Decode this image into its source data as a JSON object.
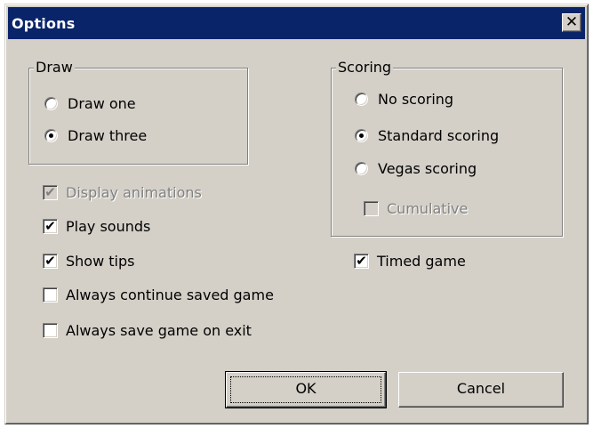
{
  "window": {
    "title": "Options",
    "close_glyph": "✕"
  },
  "draw_group": {
    "label": "Draw",
    "options": [
      {
        "label": "Draw one",
        "selected": false
      },
      {
        "label": "Draw three",
        "selected": true
      }
    ]
  },
  "scoring_group": {
    "label": "Scoring",
    "options": [
      {
        "label": "No scoring",
        "selected": false
      },
      {
        "label": "Standard scoring",
        "selected": true
      },
      {
        "label": "Vegas scoring",
        "selected": false
      }
    ],
    "cumulative": {
      "label": "Cumulative",
      "checked": false,
      "enabled": false
    }
  },
  "checkboxes": {
    "display_animations": {
      "label": "Display animations",
      "checked": true,
      "enabled": false
    },
    "play_sounds": {
      "label": "Play sounds",
      "checked": true
    },
    "show_tips": {
      "label": "Show tips",
      "checked": true
    },
    "always_continue": {
      "label": "Always continue saved game",
      "checked": false
    },
    "always_save": {
      "label": "Always save game on exit",
      "checked": false
    },
    "timed_game": {
      "label": "Timed game",
      "checked": true
    }
  },
  "buttons": {
    "ok": "OK",
    "cancel": "Cancel"
  },
  "check_glyph": "✔"
}
